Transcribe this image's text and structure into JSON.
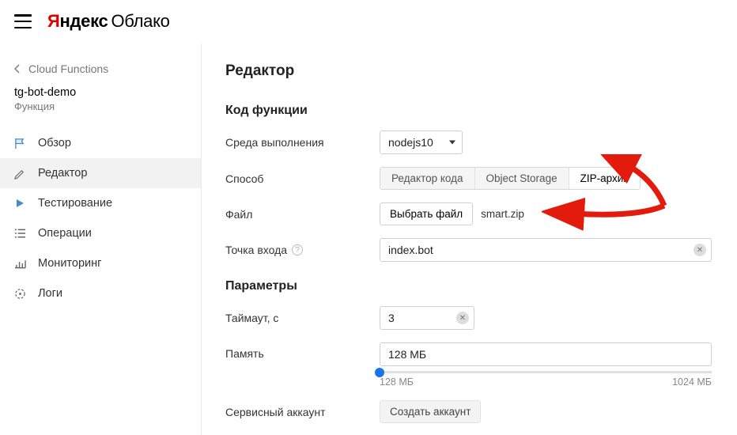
{
  "header": {
    "logo_ya": "Я",
    "logo_ndex": "ндекс",
    "logo_cloud": "Облако"
  },
  "breadcrumb": {
    "label": "Cloud Functions"
  },
  "resource": {
    "name": "tg-bot-demo",
    "type": "Функция"
  },
  "nav": [
    {
      "key": "overview",
      "label": "Обзор"
    },
    {
      "key": "editor",
      "label": "Редактор"
    },
    {
      "key": "testing",
      "label": "Тестирование"
    },
    {
      "key": "ops",
      "label": "Операции"
    },
    {
      "key": "monitor",
      "label": "Мониторинг"
    },
    {
      "key": "logs",
      "label": "Логи"
    }
  ],
  "page": {
    "title": "Редактор"
  },
  "code_section": {
    "title": "Код функции",
    "runtime_label": "Среда выполнения",
    "runtime_value": "nodejs10",
    "method_label": "Способ",
    "method_options": {
      "editor": "Редактор кода",
      "storage": "Object Storage",
      "zip": "ZIP-архив"
    },
    "file_label": "Файл",
    "file_button": "Выбрать файл",
    "file_name": "smart.zip",
    "entry_label": "Точка входа",
    "entry_value": "index.bot"
  },
  "params_section": {
    "title": "Параметры",
    "timeout_label": "Таймаут, с",
    "timeout_value": "3",
    "memory_label": "Память",
    "memory_value": "128 МБ",
    "memory_min": "128 МБ",
    "memory_max": "1024 МБ",
    "service_account_label": "Сервисный аккаунт",
    "service_account_button": "Создать аккаунт"
  }
}
